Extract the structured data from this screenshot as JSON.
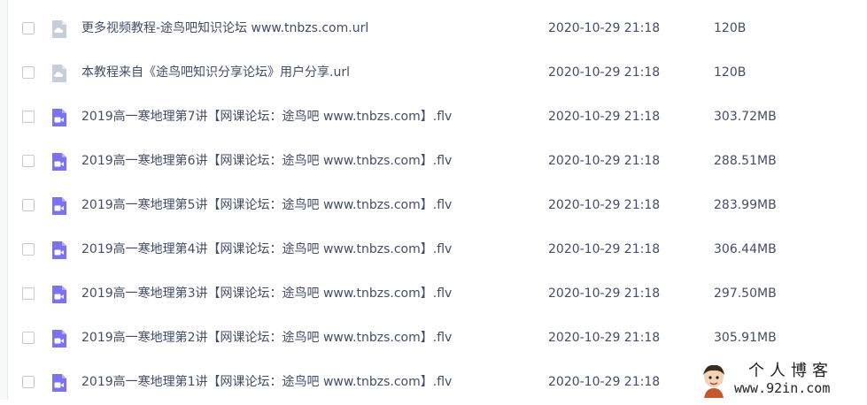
{
  "files": [
    {
      "type": "url",
      "name": "更多视频教程-途鸟吧知识论坛 www.tnbzs.com.url",
      "date": "2020-10-29 21:18",
      "size": "120B"
    },
    {
      "type": "url",
      "name": "本教程来自《途鸟吧知识分享论坛》用户分享.url",
      "date": "2020-10-29 21:18",
      "size": "120B"
    },
    {
      "type": "video",
      "name": "2019高一寒地理第7讲【网课论坛：途鸟吧 www.tnbzs.com】.flv",
      "date": "2020-10-29 21:18",
      "size": "303.72MB"
    },
    {
      "type": "video",
      "name": "2019高一寒地理第6讲【网课论坛：途鸟吧 www.tnbzs.com】.flv",
      "date": "2020-10-29 21:18",
      "size": "288.51MB"
    },
    {
      "type": "video",
      "name": "2019高一寒地理第5讲【网课论坛：途鸟吧 www.tnbzs.com】.flv",
      "date": "2020-10-29 21:18",
      "size": "283.99MB"
    },
    {
      "type": "video",
      "name": "2019高一寒地理第4讲【网课论坛：途鸟吧 www.tnbzs.com】.flv",
      "date": "2020-10-29 21:18",
      "size": "306.44MB"
    },
    {
      "type": "video",
      "name": "2019高一寒地理第3讲【网课论坛：途鸟吧 www.tnbzs.com】.flv",
      "date": "2020-10-29 21:18",
      "size": "297.50MB"
    },
    {
      "type": "video",
      "name": "2019高一寒地理第2讲【网课论坛：途鸟吧 www.tnbzs.com】.flv",
      "date": "2020-10-29 21:18",
      "size": "305.91MB"
    },
    {
      "type": "video",
      "name": "2019高一寒地理第1讲【网课论坛：途鸟吧 www.tnbzs.com】.flv",
      "date": "2020-10-29 21:18",
      "size": ""
    }
  ],
  "watermark": {
    "title": "个人博客",
    "url": "www.92in.com"
  },
  "colors": {
    "url_icon": "#c5ced9",
    "video_icon": "#7a72f0",
    "text": "#424e67",
    "checkbox_border": "#c4c9d3"
  },
  "icons": {
    "url": "cloud-link-file-icon",
    "video": "video-file-icon"
  }
}
